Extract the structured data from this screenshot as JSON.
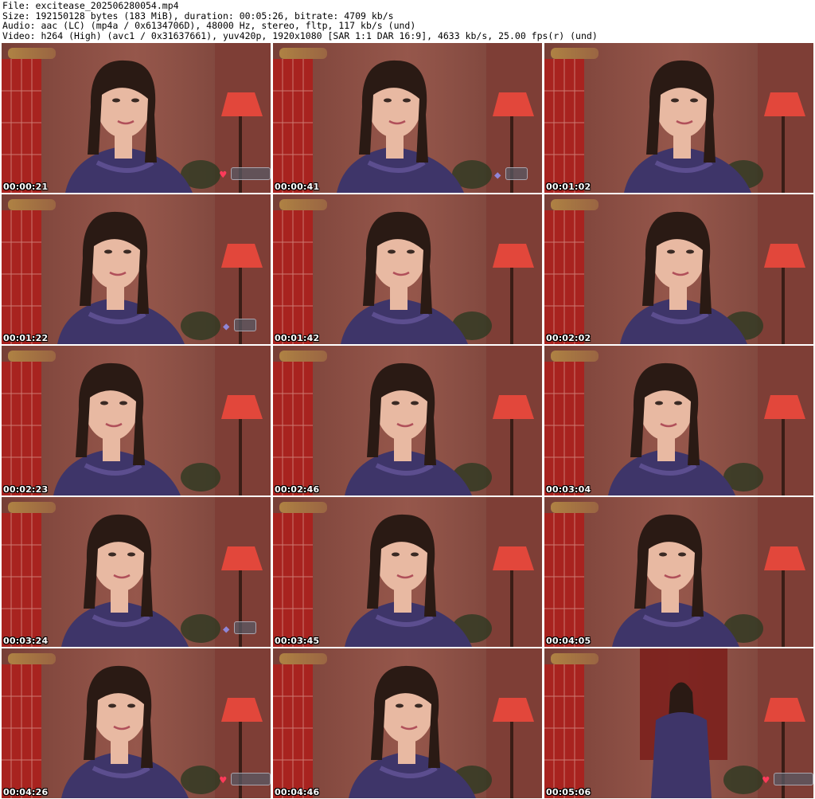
{
  "header": {
    "file_line": "File: excitease_202506280054.mp4",
    "size_line": "Size: 192150128 bytes (183 MiB), duration: 00:05:26, bitrate: 4709 kb/s",
    "audio_line": "Audio: aac (LC) (mp4a / 0x6134706D), 48000 Hz, stereo, fltp, 117 kb/s (und)",
    "video_line": "Video: h264 (High) (avc1 / 0x31637661), yuv420p, 1920x1080 [SAR 1:1 DAR 16:9], 4633 kb/s, 25.00 fps(r) (und)"
  },
  "thumbnails": [
    {
      "timestamp": "00:00:21",
      "badge": "heart"
    },
    {
      "timestamp": "00:00:41",
      "badge": "icon"
    },
    {
      "timestamp": "00:01:02",
      "badge": "none"
    },
    {
      "timestamp": "00:01:22",
      "badge": "icon"
    },
    {
      "timestamp": "00:01:42",
      "badge": "none"
    },
    {
      "timestamp": "00:02:02",
      "badge": "none"
    },
    {
      "timestamp": "00:02:23",
      "badge": "none"
    },
    {
      "timestamp": "00:02:46",
      "badge": "none"
    },
    {
      "timestamp": "00:03:04",
      "badge": "none"
    },
    {
      "timestamp": "00:03:24",
      "badge": "icon"
    },
    {
      "timestamp": "00:03:45",
      "badge": "none"
    },
    {
      "timestamp": "00:04:05",
      "badge": "none"
    },
    {
      "timestamp": "00:04:26",
      "badge": "heart"
    },
    {
      "timestamp": "00:04:46",
      "badge": "none"
    },
    {
      "timestamp": "00:05:06",
      "badge": "heart"
    }
  ],
  "colors": {
    "background": "#ffffff",
    "header_text": "#000000",
    "timestamp_text": "#ffffff",
    "wall": "#8a4c42",
    "shoji": "#a8231f",
    "lamp": "#e2473b",
    "robe": "#3e3569",
    "skin": "#e8b9a2",
    "hair": "#2a1a14"
  }
}
